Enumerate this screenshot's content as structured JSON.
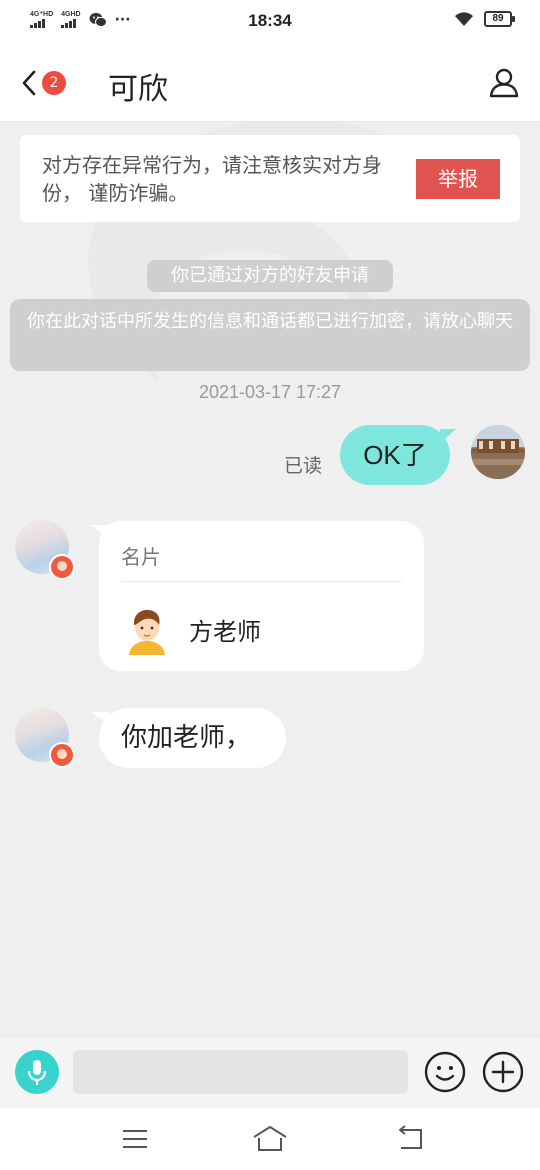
{
  "status_bar": {
    "time": "18:34",
    "sim1_label": "4G⁺HD",
    "sim2_label": "4GHD",
    "more": "···",
    "battery": "89"
  },
  "header": {
    "unread_count": "2",
    "title": "可欣"
  },
  "notice": {
    "text": "对方存在异常行为，请注意核实对方身份， 谨防诈骗。",
    "report_label": "举报"
  },
  "system_messages": {
    "friend_accepted": "你已通过对方的好友申请",
    "encryption": "你在此对话中所发生的信息和通话都已进行加密，请放心聊天"
  },
  "chat": {
    "timestamp": "2021-03-17 17:27",
    "outgoing": {
      "read_status": "已读",
      "text": "OK了"
    },
    "contact_card": {
      "label": "名片",
      "name": "方老师"
    },
    "incoming_text": "你加老师，"
  },
  "input_bar": {
    "value": ""
  },
  "colors": {
    "accent": "#38d3cd",
    "outgoing_bubble": "#7ee6dc",
    "report": "#e05350",
    "badge": "#f04a3e"
  },
  "icons": {
    "back": "chevron-left-icon",
    "profile": "person-icon",
    "mic": "mic-icon",
    "emoji": "smiley-icon",
    "plus": "plus-circle-icon",
    "nav_menu": "menu-icon",
    "nav_home": "home-icon",
    "nav_back": "return-icon"
  }
}
